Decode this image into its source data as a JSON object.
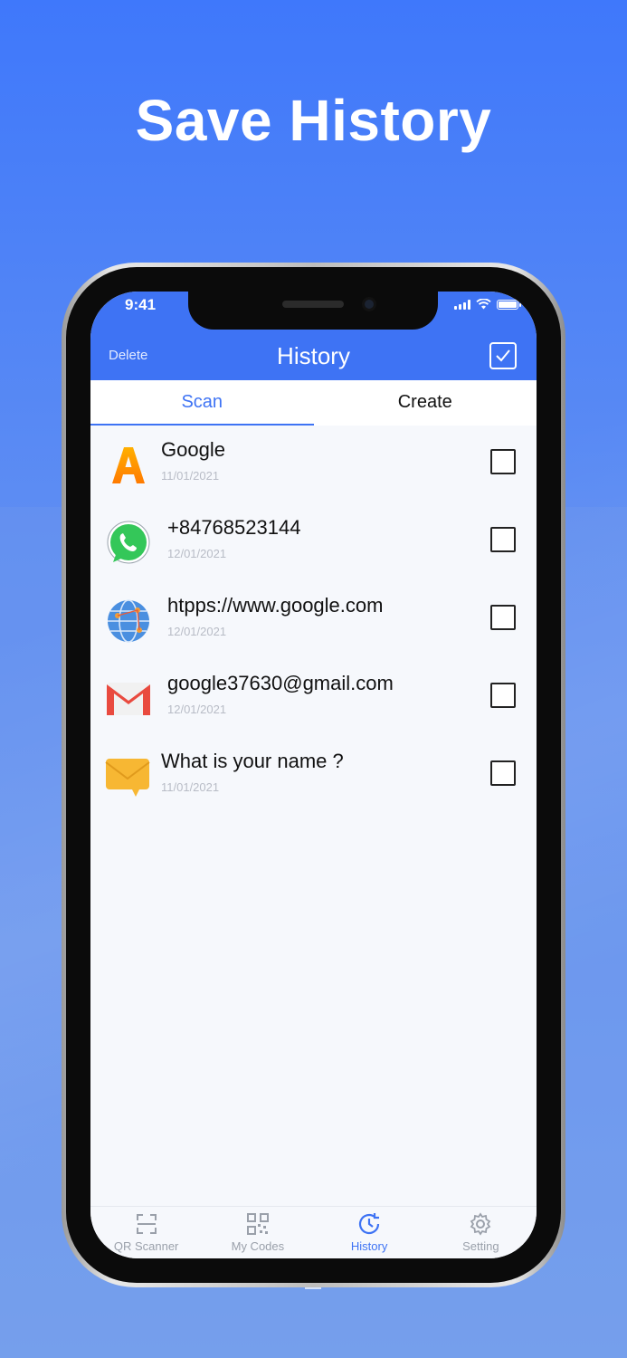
{
  "promo": {
    "title": "Save History"
  },
  "status": {
    "time": "9:41"
  },
  "header": {
    "delete_label": "Delete",
    "title": "History"
  },
  "tabs": [
    {
      "label": "Scan",
      "active": true
    },
    {
      "label": "Create",
      "active": false
    }
  ],
  "items": [
    {
      "title": "Google",
      "date": "11/01/2021",
      "icon": "font-a-icon"
    },
    {
      "title": "+84768523144",
      "date": "12/01/2021",
      "icon": "whatsapp-phone-icon"
    },
    {
      "title": "htpps://www.google.com",
      "date": "12/01/2021",
      "icon": "globe-icon"
    },
    {
      "title": "google37630@gmail.com",
      "date": "12/01/2021",
      "icon": "gmail-icon"
    },
    {
      "title": "What is your name ?",
      "date": "11/01/2021",
      "icon": "message-envelope-icon"
    }
  ],
  "tabbar": [
    {
      "label": "QR Scanner",
      "icon": "qr-scan-icon",
      "active": false
    },
    {
      "label": "My Codes",
      "icon": "qr-code-icon",
      "active": false
    },
    {
      "label": "History",
      "icon": "history-clock-icon",
      "active": true
    },
    {
      "label": "Setting",
      "icon": "gear-icon",
      "active": false
    }
  ],
  "colors": {
    "accent": "#3e73f4",
    "background": "#f6f8fc",
    "date_text": "#b8bcc6"
  }
}
